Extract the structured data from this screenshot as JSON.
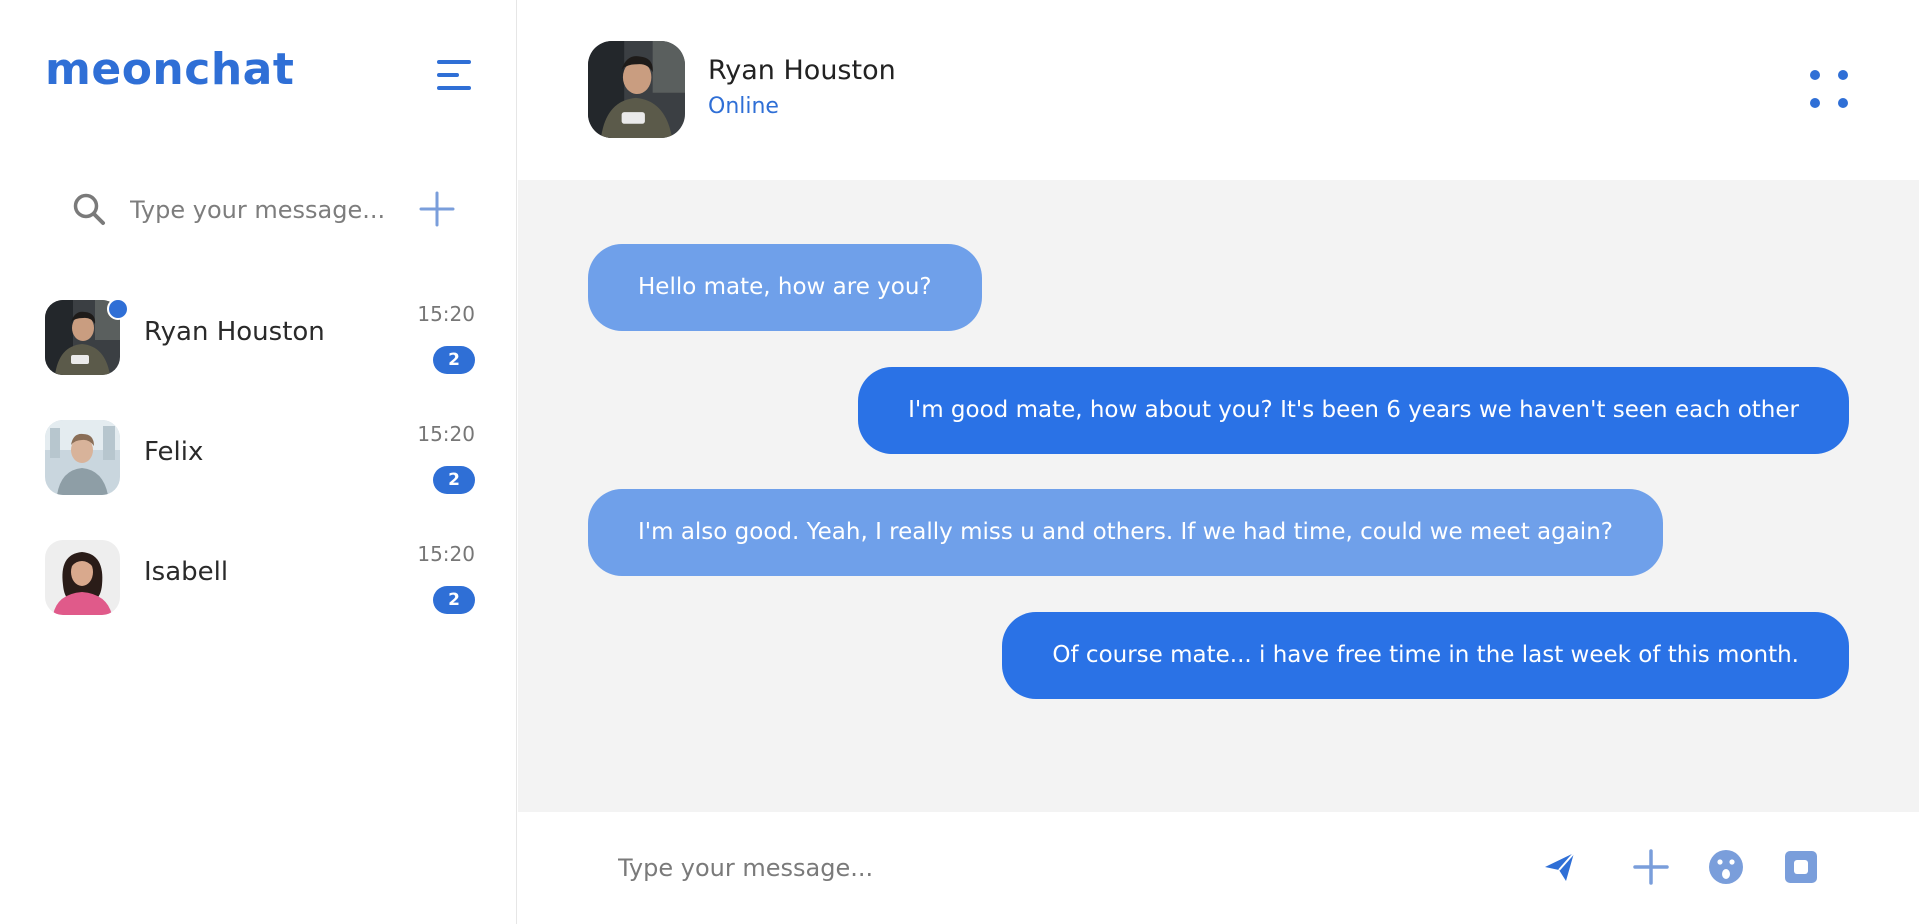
{
  "app": {
    "brand": "meonchat"
  },
  "sidebar": {
    "search": {
      "placeholder": "Type your message..."
    },
    "contacts": [
      {
        "name": "Ryan Houston",
        "time": "15:20",
        "unread": "2",
        "online": true
      },
      {
        "name": "Felix",
        "time": "15:20",
        "unread": "2",
        "online": false
      },
      {
        "name": "Isabell",
        "time": "15:20",
        "unread": "2",
        "online": false
      }
    ]
  },
  "chat": {
    "contact_name": "Ryan Houston",
    "status": "Online",
    "messages": [
      {
        "direction": "in",
        "text": "Hello mate, how are you?"
      },
      {
        "direction": "out",
        "text": "I'm good mate, how about you? It's been 6 years we haven't seen each other"
      },
      {
        "direction": "in",
        "text": "I'm also good. Yeah, I really miss u and others. If we had time, could we meet again?"
      },
      {
        "direction": "out",
        "text": "Of course mate... i have free time in the last week of this month."
      }
    ],
    "composer": {
      "placeholder": "Type your message..."
    }
  },
  "icons": {
    "menu": "hamburger-menu-icon",
    "search": "search-icon",
    "add": "plus-icon",
    "more": "more-dots-icon",
    "send": "send-icon",
    "emoji": "emoji-icon",
    "image": "image-icon"
  },
  "colors": {
    "accent": "#2f6fd6",
    "bubble_in": "#6fa0ea",
    "bubble_out": "#2a72e6",
    "chat_bg": "#f3f3f3"
  }
}
